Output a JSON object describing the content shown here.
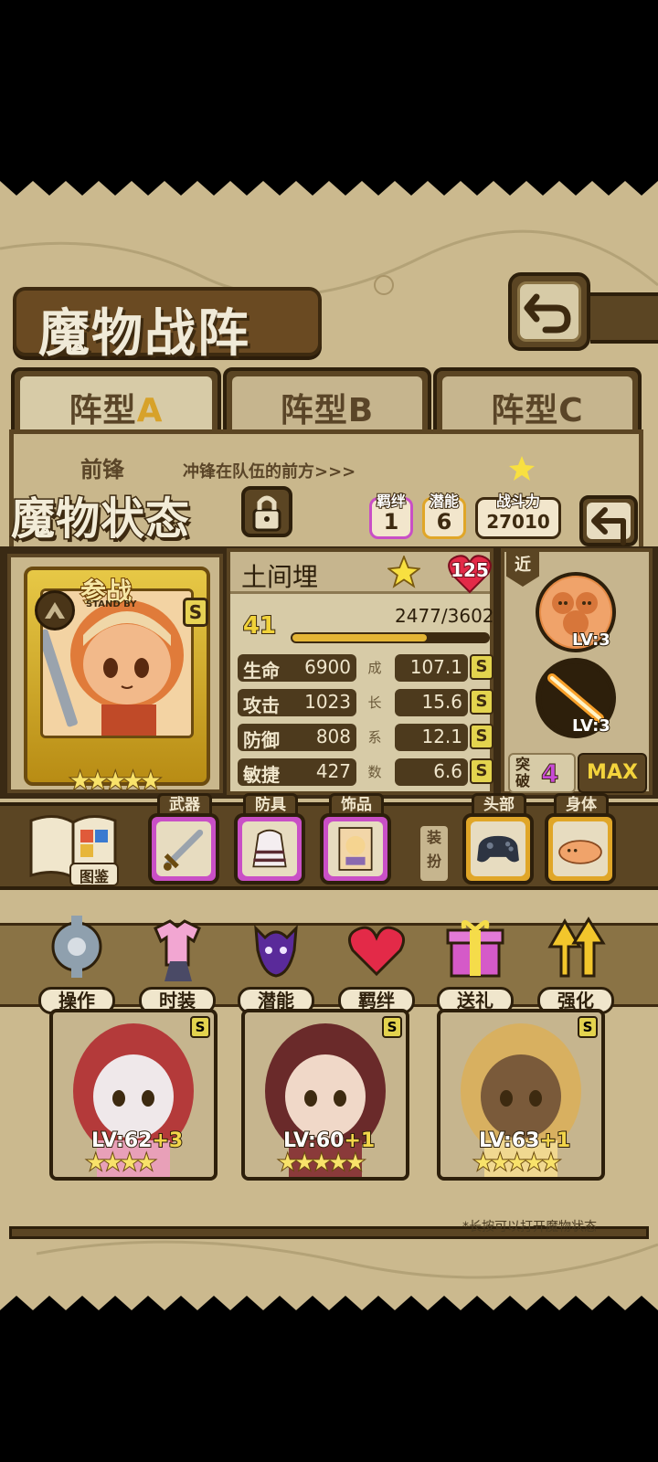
{
  "header": {
    "title": "魔物战阵"
  },
  "tabs": [
    {
      "prefix": "阵型",
      "suffix": "A",
      "selected": true
    },
    {
      "prefix": "阵型",
      "suffix": "B",
      "selected": false
    },
    {
      "prefix": "阵型",
      "suffix": "C",
      "selected": false
    }
  ],
  "front": {
    "label": "前锋",
    "desc": "冲锋在队伍的前方>>>"
  },
  "status": {
    "title": "魔物状态",
    "bond": {
      "label": "羁绊",
      "value": "1"
    },
    "potential": {
      "label": "潜能",
      "value": "6"
    },
    "power": {
      "label": "战斗力",
      "value": "27010"
    }
  },
  "monster": {
    "standby_label": "参战",
    "standby_sub": "STAND BY",
    "rarity": "S",
    "stars": "★★★★★",
    "name": "土间埋",
    "affection": "125",
    "level": "41",
    "xp_text": "2477/3602",
    "xp_fraction": 0.6877,
    "growth_label": "成长系数",
    "stats": [
      {
        "label": "生命",
        "value": "6900",
        "growth": "107.1",
        "grade": "S"
      },
      {
        "label": "攻击",
        "value": "1023",
        "growth": "15.6",
        "grade": "S"
      },
      {
        "label": "防御",
        "value": "808",
        "growth": "12.1",
        "grade": "S"
      },
      {
        "label": "敏捷",
        "value": "427",
        "growth": "6.6",
        "grade": "S"
      }
    ]
  },
  "skills": {
    "range_tag": "近",
    "items": [
      {
        "level": "LV:3"
      },
      {
        "level": "LV:3"
      }
    ],
    "break_label": "突破",
    "break_value": "4",
    "max_label": "MAX"
  },
  "equipment": {
    "book_label": "图鉴",
    "slots": [
      {
        "tag": "武器",
        "icon": "sword-icon"
      },
      {
        "tag": "防具",
        "icon": "dress-armor-icon"
      },
      {
        "tag": "饰品",
        "icon": "portrait-card-icon"
      },
      {
        "tag": "头部",
        "icon": "gamepad-icon"
      },
      {
        "tag": "身体",
        "icon": "plush-body-icon"
      }
    ],
    "dress_label": "装扮"
  },
  "actions": [
    {
      "label": "操作",
      "icon": "gear-icon"
    },
    {
      "label": "时装",
      "icon": "outfit-icon"
    },
    {
      "label": "潜能",
      "icon": "demon-icon"
    },
    {
      "label": "羁绊",
      "icon": "hearts-icon"
    },
    {
      "label": "送礼",
      "icon": "gift-icon"
    },
    {
      "label": "强化",
      "icon": "arrows-up-icon"
    }
  ],
  "team": [
    {
      "level": "LV:62",
      "plus": "+3",
      "stars": "★★★★",
      "grade": "S"
    },
    {
      "level": "LV:60",
      "plus": "+1",
      "stars": "★★★★★",
      "grade": "S"
    },
    {
      "level": "LV:63",
      "plus": "+1",
      "stars": "★★★★★",
      "grade": "S"
    }
  ],
  "hint": "*长按可以打开魔物状态",
  "colors": {
    "panel_dark": "#5b4523",
    "parchment": "#d7cba7",
    "gold": "#e3d34e",
    "pink": "#c94fc6"
  }
}
